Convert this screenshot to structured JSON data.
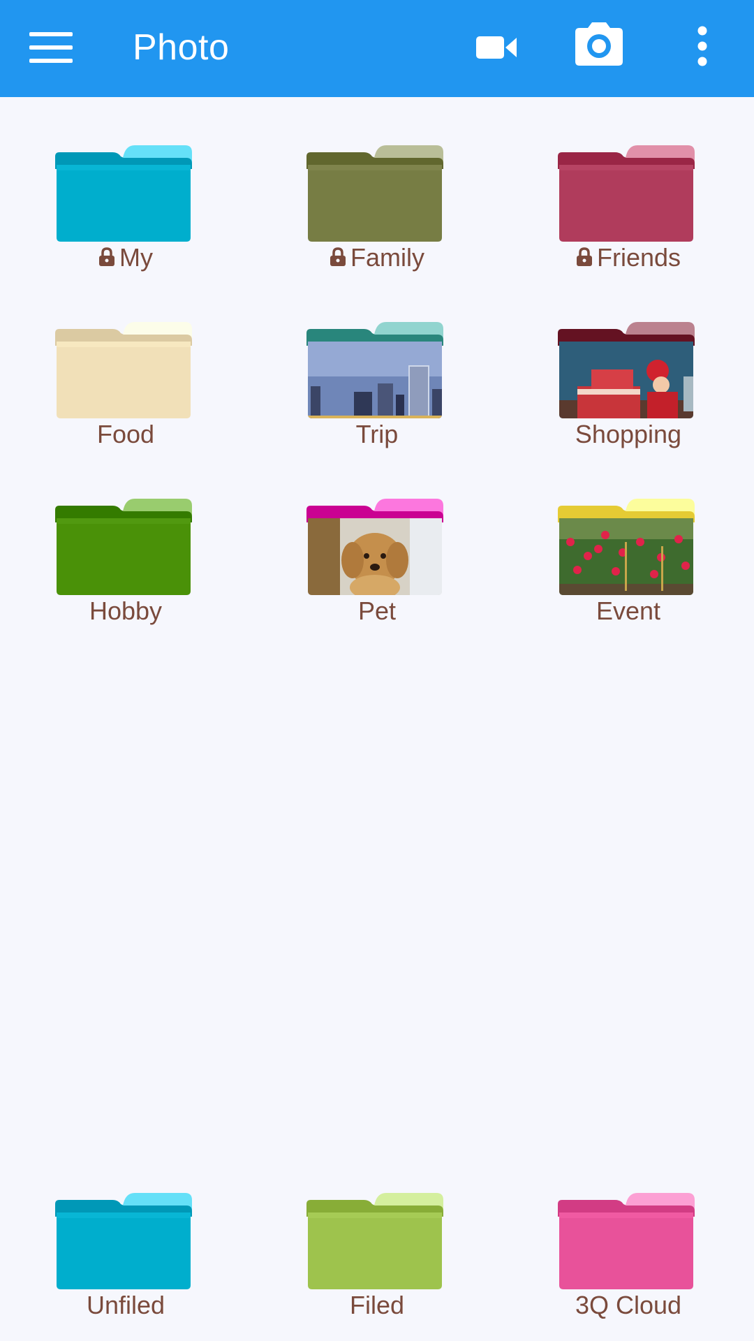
{
  "header": {
    "menu_icon": "hamburger-menu-icon",
    "title": "Photo",
    "actions": [
      {
        "name": "video-camera-icon"
      },
      {
        "name": "camera-icon"
      },
      {
        "name": "more-vertical-icon"
      }
    ],
    "color": "#2196f0"
  },
  "folders": [
    {
      "label": "My",
      "locked": true,
      "color": "#00aecd",
      "thumbnail": null
    },
    {
      "label": "Family",
      "locked": true,
      "color": "#777d44",
      "thumbnail": null
    },
    {
      "label": "Friends",
      "locked": true,
      "color": "#b03c5c",
      "thumbnail": null
    },
    {
      "label": "Food",
      "locked": false,
      "color": "#f1e0b8",
      "thumbnail": null
    },
    {
      "label": "Trip",
      "locked": false,
      "color": "#3f9c92",
      "thumbnail": "city-skyline-photo"
    },
    {
      "label": "Shopping",
      "locked": false,
      "color": "#7a2838",
      "thumbnail": "gift-shopping-photo"
    },
    {
      "label": "Hobby",
      "locked": false,
      "color": "#4a9108",
      "thumbnail": null
    },
    {
      "label": "Pet",
      "locked": false,
      "color": "#e018a8",
      "thumbnail": "puppy-photo"
    },
    {
      "label": "Event",
      "locked": false,
      "color": "#fbe14a",
      "thumbnail": "flower-garden-photo"
    }
  ],
  "bottom_folders": [
    {
      "label": "Unfiled",
      "locked": false,
      "color": "#00aecd"
    },
    {
      "label": "Filed",
      "locked": false,
      "color": "#9ec34d"
    },
    {
      "label": "3Q Cloud",
      "locked": false,
      "color": "#e8529a"
    }
  ],
  "text_color": "#7a4a3c",
  "background": "#f6f7fd"
}
